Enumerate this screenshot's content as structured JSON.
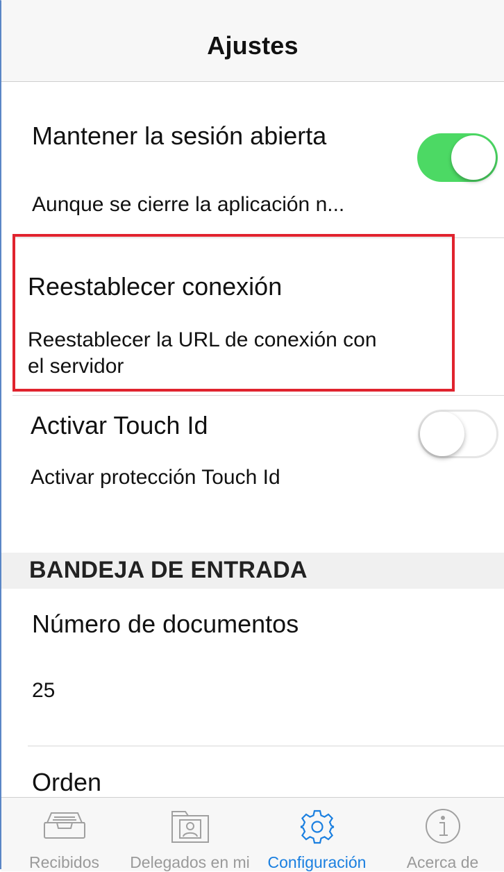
{
  "navbar": {
    "title": "Ajustes"
  },
  "settings": {
    "keep_session": {
      "title": "Mantener la sesión abierta",
      "subtitle": "Aunque se cierre la aplicación n...",
      "toggle_on": true
    },
    "reset_connection": {
      "title": "Reestablecer conexión",
      "subtitle_line1": "Reestablecer la URL de conexión con",
      "subtitle_line2": "el servidor"
    },
    "touch_id": {
      "title": "Activar Touch Id",
      "subtitle": "Activar protección Touch Id",
      "toggle_on": false
    }
  },
  "inbox_section": {
    "header": "BANDEJA DE ENTRADA",
    "doc_count": {
      "title": "Número de documentos",
      "value": "25"
    },
    "order": {
      "title": "Orden"
    }
  },
  "tabbar": {
    "tabs": [
      {
        "label": "Recibidos",
        "icon": "inbox-tray-icon",
        "active": false
      },
      {
        "label": "Delegados en mi",
        "icon": "delegated-folder-icon",
        "active": false
      },
      {
        "label": "Configuración",
        "icon": "gear-icon",
        "active": true
      },
      {
        "label": "Acerca de",
        "icon": "info-icon",
        "active": false
      }
    ]
  },
  "colors": {
    "toggle_on": "#4cd964",
    "active_tab": "#1a7fe0",
    "highlight_box": "#e0232e",
    "inactive_tab": "#9a9a9a"
  }
}
